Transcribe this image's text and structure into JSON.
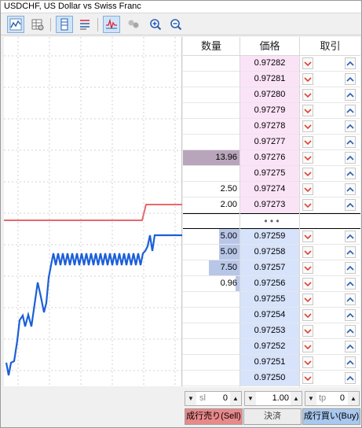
{
  "window": {
    "title": "USDCHF, US Dollar vs Swiss Franc"
  },
  "toolbar": {
    "buttons": [
      {
        "icon": "chart-line-icon",
        "active": true
      },
      {
        "icon": "table-icon",
        "active": false
      },
      {
        "icon": "book-column-icon",
        "active": true
      },
      {
        "icon": "order-list-icon",
        "active": false
      },
      {
        "icon": "tick-chart-icon",
        "active": true
      },
      {
        "icon": "circles-icon",
        "active": false
      },
      {
        "icon": "zoom-in-icon",
        "active": false
      },
      {
        "icon": "zoom-out-icon",
        "active": false
      }
    ]
  },
  "book": {
    "headers": {
      "volume": "数量",
      "price": "価格",
      "trade": "取引"
    },
    "separator": "• • •",
    "asks": [
      {
        "volume": "",
        "price": "0.97282"
      },
      {
        "volume": "",
        "price": "0.97281"
      },
      {
        "volume": "",
        "price": "0.97280"
      },
      {
        "volume": "",
        "price": "0.97279"
      },
      {
        "volume": "",
        "price": "0.97278"
      },
      {
        "volume": "",
        "price": "0.97277"
      },
      {
        "volume": "13.96",
        "price": "0.97276",
        "fill": 1.0
      },
      {
        "volume": "",
        "price": "0.97275"
      },
      {
        "volume": "2.50",
        "price": "0.97274"
      },
      {
        "volume": "2.00",
        "price": "0.97273"
      }
    ],
    "bids": [
      {
        "volume": "5.00",
        "price": "0.97259",
        "fill": 0.36
      },
      {
        "volume": "5.00",
        "price": "0.97258",
        "fill": 0.36
      },
      {
        "volume": "7.50",
        "price": "0.97257",
        "fill": 0.54
      },
      {
        "volume": "0.96",
        "price": "0.97256",
        "fill": 0.07
      },
      {
        "volume": "",
        "price": "0.97255"
      },
      {
        "volume": "",
        "price": "0.97254"
      },
      {
        "volume": "",
        "price": "0.97253"
      },
      {
        "volume": "",
        "price": "0.97252"
      },
      {
        "volume": "",
        "price": "0.97251"
      },
      {
        "volume": "",
        "price": "0.97250"
      }
    ]
  },
  "controls": {
    "sl_placeholder": "sl",
    "sl_value": "0",
    "volume_value": "1.00",
    "tp_placeholder": "tp",
    "tp_value": "0",
    "sell_label": "成行売り(Sell)",
    "close_label": "決済",
    "buy_label": "成行買い(Buy)"
  },
  "colors": {
    "ask_bg": "#fbe3f7",
    "bid_bg": "#d7e3fb",
    "ask_line": "#e8696b",
    "bid_line": "#1b5fd8",
    "ask_vol_bar": "#b9a5bb",
    "bid_vol_bar": "#b8c6e8",
    "sell_btn": "#e8898a",
    "buy_btn": "#a9c8ef"
  }
}
